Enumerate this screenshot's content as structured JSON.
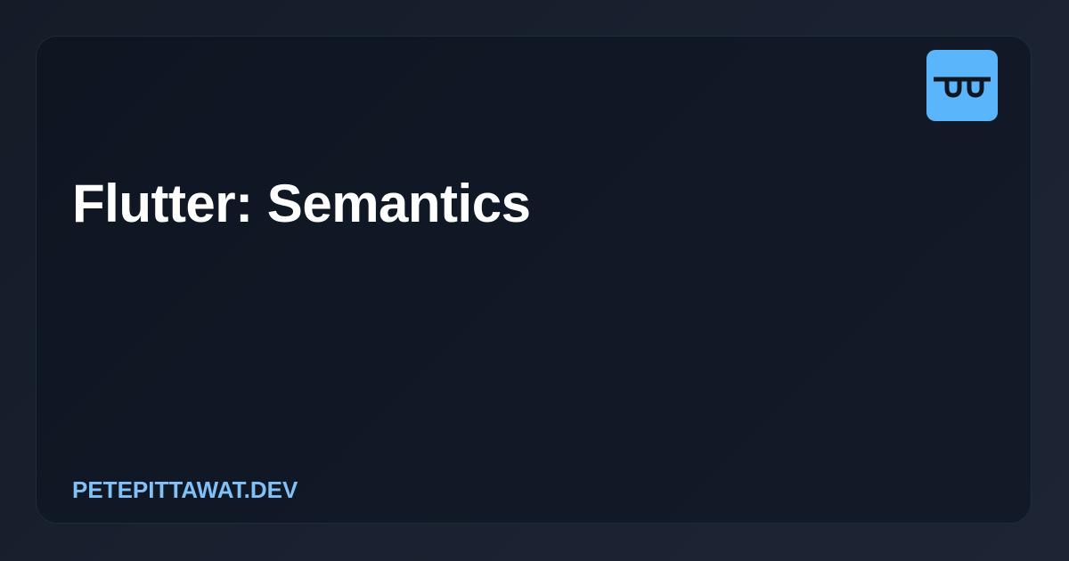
{
  "card": {
    "title": "Flutter: Semantics",
    "site_label": "PETEPITTAWAT.DEV",
    "logo_icon": "glasses-logo-icon"
  },
  "colors": {
    "background": "#181f2d",
    "card_background": "#111927",
    "logo_background": "#5bb5fb",
    "title": "#ffffff",
    "site_label": "#81c1f7"
  }
}
